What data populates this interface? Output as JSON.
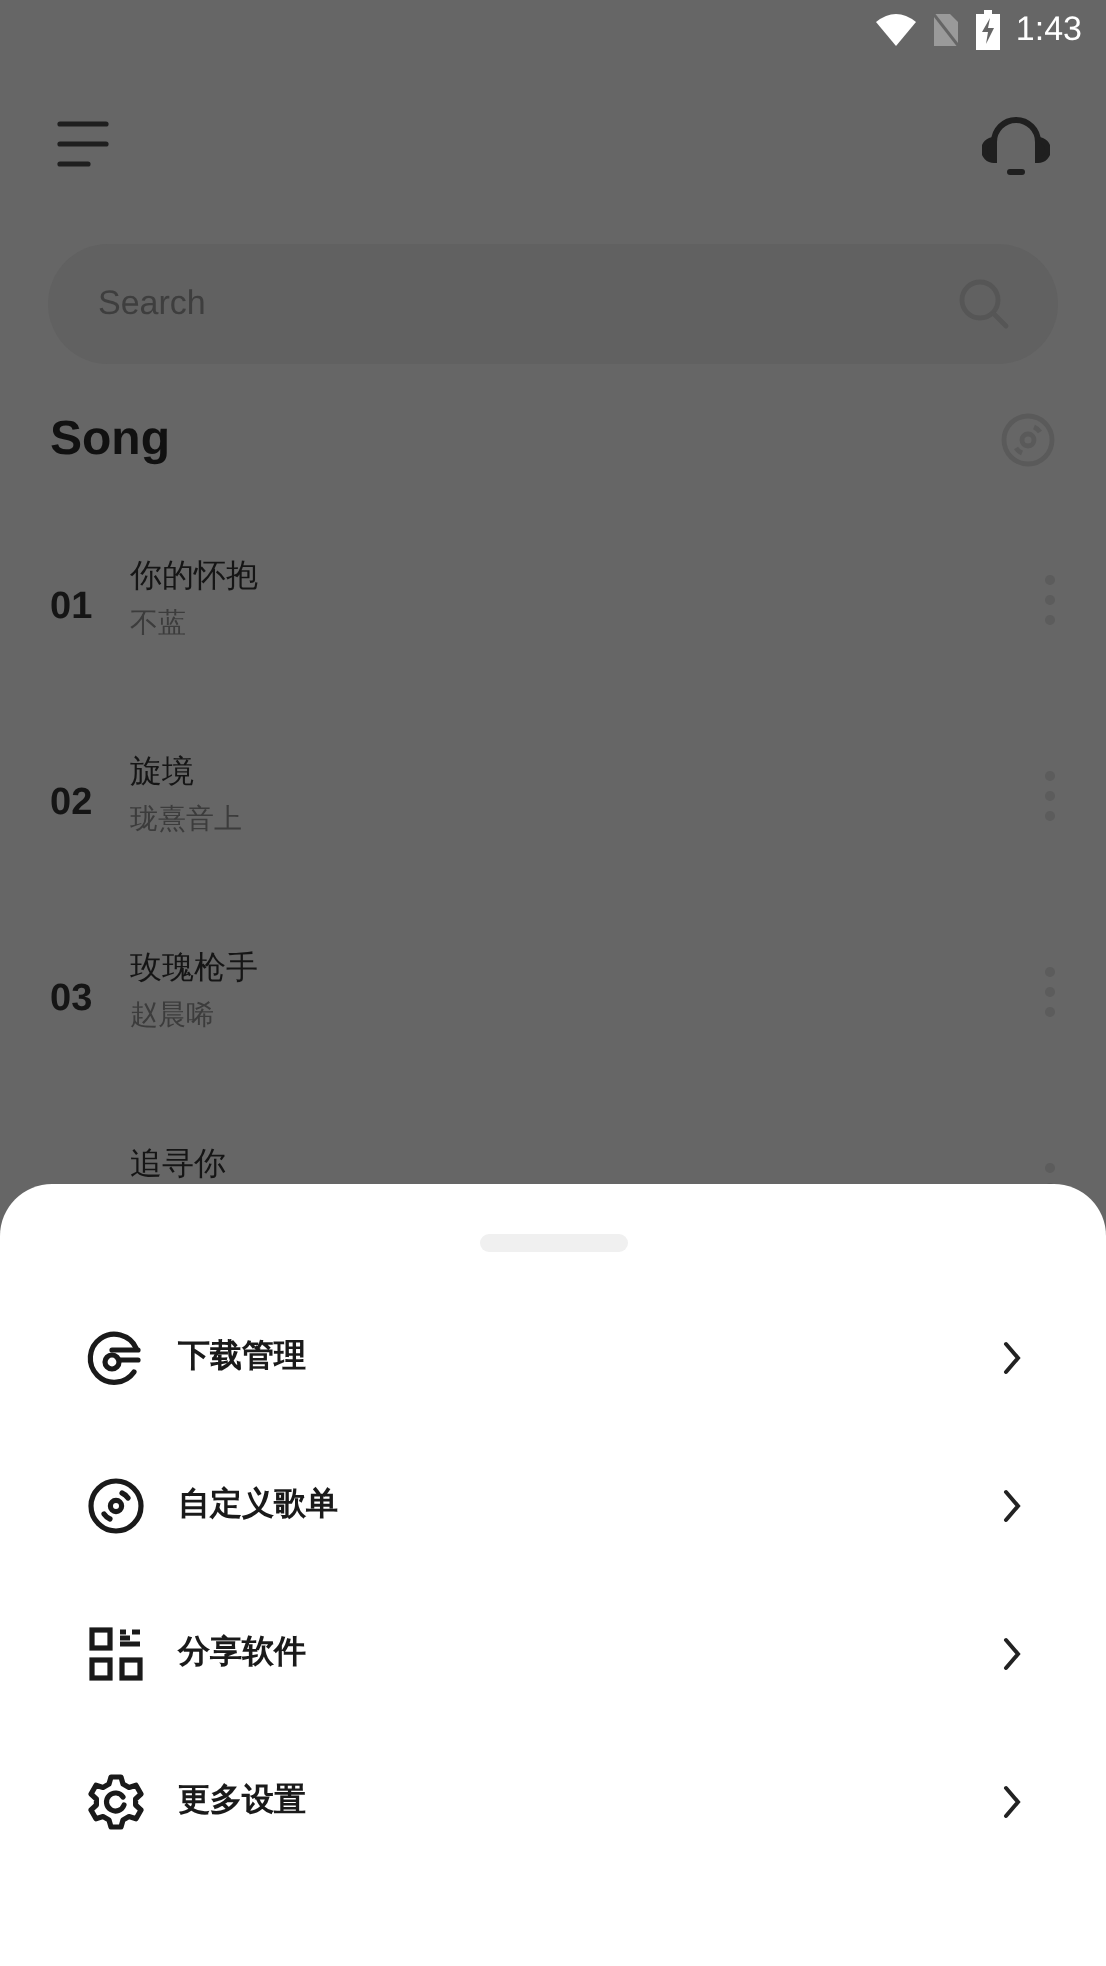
{
  "status_bar": {
    "time": "1:43"
  },
  "search": {
    "placeholder": "Search"
  },
  "section": {
    "title": "Song"
  },
  "songs": [
    {
      "number": "01",
      "title": "你的怀抱",
      "artist": "不蓝"
    },
    {
      "number": "02",
      "title": "旋境",
      "artist": "珑熹音上"
    },
    {
      "number": "03",
      "title": "玫瑰枪手",
      "artist": "赵晨唏"
    },
    {
      "title": "追寻你"
    }
  ],
  "sheet": {
    "items": [
      {
        "kind": "download",
        "label": "下载管理"
      },
      {
        "kind": "playlist",
        "label": "自定义歌单"
      },
      {
        "kind": "share",
        "label": "分享软件"
      },
      {
        "kind": "settings",
        "label": "更多设置"
      }
    ]
  }
}
